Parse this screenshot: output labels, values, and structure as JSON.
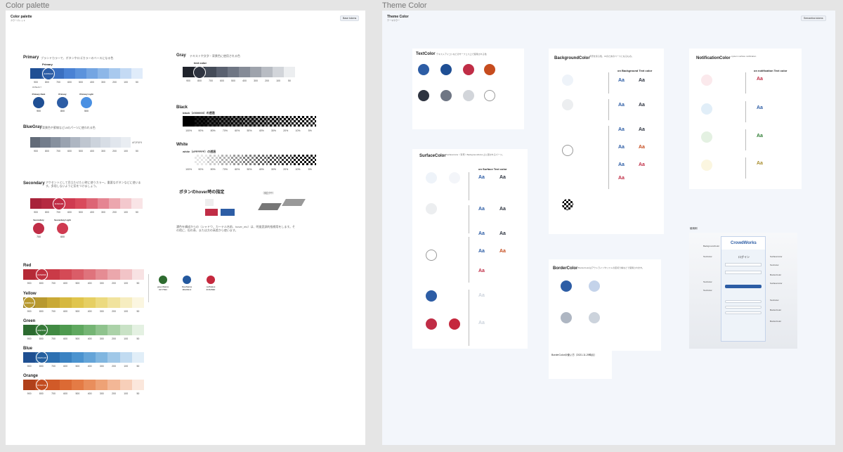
{
  "left_frame": {
    "title": "Color palette",
    "header": "Color palette",
    "subheader": "カラーパレット",
    "tokens_button": "Base tokens"
  },
  "right_frame": {
    "title": "Theme Color",
    "header": "Theme Color",
    "subheader": "テーマカラー",
    "tokens_button": "Semantics tokens"
  },
  "ticks": [
    "900",
    "800",
    "700",
    "600",
    "500",
    "400",
    "300",
    "200",
    "100",
    "50"
  ],
  "ticks_pct": [
    "100%",
    "90%",
    "80%",
    "70%",
    "60%",
    "50%",
    "40%",
    "30%",
    "20%",
    "10%",
    "5%"
  ],
  "primary": {
    "name": "Primary",
    "desc": "ブランドカラーで、ボタンやロゴカラーのベースになる色",
    "main_label": "Primary",
    "main_hex": "#2D5DA5",
    "swatches": [
      "#1f4f94",
      "#2d5da5",
      "#3a6fc0",
      "#4a82d4",
      "#5c93dc",
      "#74a5e2",
      "#8db7e8",
      "#a8c9ee",
      "#c4daf4",
      "#e0ecfa"
    ],
    "extra": "#D5EAF7",
    "variants": [
      {
        "label": "Primary Dark",
        "tick": "900",
        "color": "#1f4f94"
      },
      {
        "label": "Primary",
        "tick": "800",
        "color": "#2d5da5"
      },
      {
        "label": "Primary Light",
        "tick": "500",
        "color": "#4a90e2"
      }
    ]
  },
  "bluegray": {
    "name": "BlueGray",
    "desc": "背景色や罫線などUIのパーツに使われる色",
    "swatches": [
      "#626b78",
      "#737d8c",
      "#86909e",
      "#9aa3b0",
      "#aeb6c2",
      "#bfc6d0",
      "#ccd3dc",
      "#d7dde5",
      "#e1e6ed",
      "#e9edf2"
    ],
    "extra": "#F2F5F9"
  },
  "secondary": {
    "name": "Secondary",
    "desc": "アクセントとして目立たせたい時に使うカラー。重要なボタンなどに使います。多用しないように気をつけましょう。",
    "main_hex": "#C8244B",
    "swatches": [
      "#a8233a",
      "#b52a41",
      "#c02d46",
      "#cf3a50",
      "#d94a5c",
      "#dd6575",
      "#e58592",
      "#eca6ae",
      "#f3c8cd",
      "#f9e4e6"
    ],
    "variants": [
      {
        "label": "Secondary",
        "tick": "700",
        "color": "#c02d46"
      },
      {
        "label": "Secondary Light",
        "tick": "600",
        "color": "#cf3a50"
      }
    ]
  },
  "gray": {
    "name": "Gray",
    "desc": "テキストや文字・背景色に使用される色",
    "main_label": "text color",
    "swatches": [
      "#20242c",
      "#2e3440",
      "#444b58",
      "#5a6170",
      "#6f7684",
      "#858b97",
      "#9ea3ac",
      "#b8bcc3",
      "#d2d5da",
      "#eceef0"
    ]
  },
  "black": {
    "name": "Black",
    "desc": "black（#000000）の透過"
  },
  "white": {
    "name": "White",
    "desc": "white（#FFFFFF）の透過"
  },
  "hover": {
    "title": "ボタンのhover時の指定",
    "note": "（検討中）",
    "desc": "濃色を構成からの（シャドウ、カーテル名前、hover_etc）は、明度変調的指標用をします。その他に、但の表、または方の高差から使います。"
  },
  "red": {
    "name": "Red",
    "main_hex": "#C5283D",
    "swatches": [
      "#b52a36",
      "#c0313f",
      "#ca3a47",
      "#d44a56",
      "#da5d68",
      "#df737c",
      "#e58c93",
      "#eba7ac",
      "#f2c4c7",
      "#f8e2e3"
    ]
  },
  "yellow": {
    "name": "Yellow",
    "main_hex": "#A88D2D",
    "swatches": [
      "#a1862a",
      "#b8992f",
      "#c9a936",
      "#d6b83f",
      "#e0c54c",
      "#e6cf62",
      "#ecda7f",
      "#f1e39e",
      "#f6edc0",
      "#fbf6e0"
    ]
  },
  "green": {
    "name": "Green",
    "main_hex": "#2E7D32",
    "swatches": [
      "#2c6b30",
      "#367a39",
      "#418a43",
      "#4e9a4f",
      "#5fa85f",
      "#75b574",
      "#8fc38d",
      "#abd2a8",
      "#c9e2c6",
      "#e4f1e2"
    ]
  },
  "blue": {
    "name": "Blue",
    "main_hex": "#1E5CA8",
    "swatches": [
      "#1e4f91",
      "#25609f",
      "#2d70b1",
      "#3a82c2",
      "#4b93cf",
      "#64a4d8",
      "#80b6e0",
      "#a0c8e8",
      "#c1dbf1",
      "#e1eef8"
    ]
  },
  "orange": {
    "name": "Orange",
    "main_hex": "#C64C1E",
    "swatches": [
      "#b0401a",
      "#c24c20",
      "#d15a28",
      "#dc6a34",
      "#e47b45",
      "#e98e5c",
      "#ee a276",
      "#f3b796",
      "#f7cfb9",
      "#fbe7dc"
    ]
  },
  "status": [
    {
      "label": "greenStatus",
      "hex": "#177833",
      "color": "#2e6b2f"
    },
    {
      "label": "blueStatus",
      "hex": "#0A66C2",
      "color": "#23589e"
    },
    {
      "label": "redStatus",
      "hex": "#C5283D",
      "color": "#c5283d"
    }
  ],
  "theme": {
    "text_color": {
      "title": "TextColor",
      "desc": "テキストアイコンなどのサーフェス上で使用される色"
    },
    "background_color": {
      "title": "BackgroundColor",
      "desc": "背景を塗る色、UIのためのベースとなるもの。",
      "col_title": "on Background Text color"
    },
    "notification_color": {
      "title": "NotificationColor",
      "desc": "system surface notification",
      "col_title": "on notification Text color"
    },
    "surface_color": {
      "title": "SurfaceColor",
      "desc": "SurfaceColor（背景）BackgroundColor上に置かれるパーツ。",
      "col_title": "on Surface Text color"
    },
    "border_color": {
      "title": "BorderColor",
      "desc": "BorderColorはアウトラインやリストの区切り線などで使用されます。"
    },
    "border_usage": {
      "title": "BorderColorの使い方（2021.11.29時点）"
    },
    "aa": "Aa",
    "usage": {
      "title": "使用例",
      "brand": "CrowdWorks",
      "login": "ログイン",
      "side_left": [
        "BackgroundColor",
        "TextColor",
        "TextColor",
        "TextColor"
      ],
      "side_right": [
        "SurfaceColor",
        "TextColor",
        "BorderColor",
        "SurfaceColor",
        "TextColor",
        "BorderColor",
        "BorderColor"
      ]
    }
  }
}
